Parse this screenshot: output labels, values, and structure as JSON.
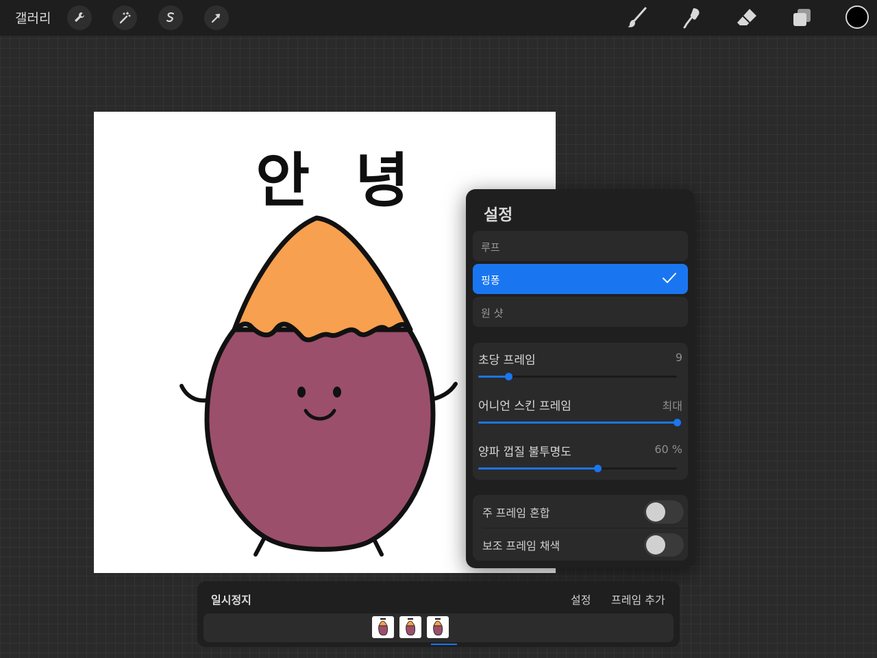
{
  "toolbar": {
    "gallery_label": "갤러리",
    "left_tools": [
      "wrench-icon",
      "magic-wand-icon",
      "selection-icon",
      "transform-arrow-icon"
    ],
    "right_tools": [
      "brush-icon",
      "smudge-icon",
      "eraser-icon",
      "layers-icon"
    ],
    "current_color": "#000000"
  },
  "canvas": {
    "text": "안 녕",
    "character": {
      "top_color": "#f7a04f",
      "body_color": "#9b4f6a"
    }
  },
  "settings": {
    "title": "설정",
    "modes": [
      {
        "label": "루프",
        "selected": false
      },
      {
        "label": "핑퐁",
        "selected": true
      },
      {
        "label": "원 샷",
        "selected": false
      }
    ],
    "sliders": [
      {
        "label": "초당 프레임",
        "value": "9",
        "level": 0.15
      },
      {
        "label": "어니언 스킨 프레임",
        "value": "최대",
        "level": 1.0
      },
      {
        "label": "양파 껍질 불투명도",
        "value": "60 %",
        "level": 0.6
      }
    ],
    "toggles": [
      {
        "label": "주 프레임 혼합",
        "on": false
      },
      {
        "label": "보조 프레임 채색",
        "on": false
      }
    ]
  },
  "animation_bar": {
    "pause_label": "일시정지",
    "settings_label": "설정",
    "add_frame_label": "프레임 추가",
    "frame_count": 3,
    "selected_frame": 3
  },
  "colors": {
    "accent": "#1a76f0",
    "panel": "#1f1f1f"
  }
}
